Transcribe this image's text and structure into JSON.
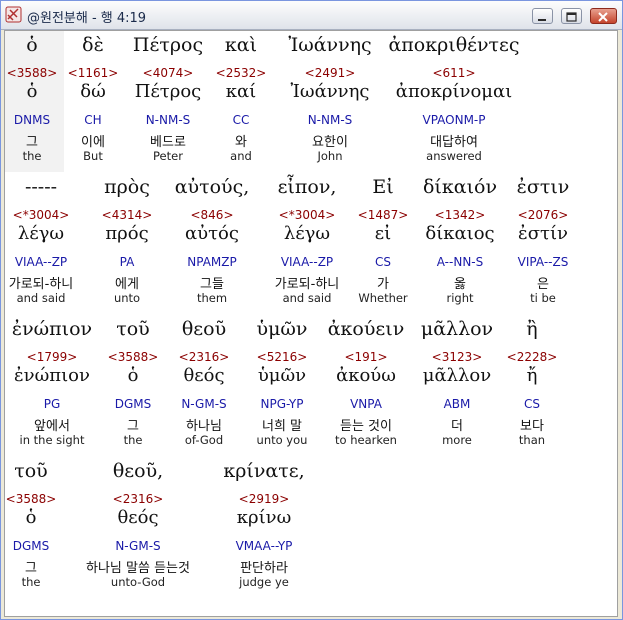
{
  "window": {
    "title": "@원전분해 - 행 4:19"
  },
  "rows": [
    [
      {
        "greek": "ὁ",
        "strong": "<3588>",
        "lemma": "ὁ",
        "parse": "DNMS",
        "korean": "그",
        "english": "the"
      },
      {
        "greek": "δὲ",
        "strong": "<1161>",
        "lemma": "δώ",
        "parse": "CH",
        "korean": "이에",
        "english": "But"
      },
      {
        "greek": "Πέτρος",
        "strong": "<4074>",
        "lemma": "Πέτρος",
        "parse": "N-NM-S",
        "korean": "베드로",
        "english": "Peter"
      },
      {
        "greek": "καὶ",
        "strong": "<2532>",
        "lemma": "καί",
        "parse": "CC",
        "korean": "와",
        "english": "and"
      },
      {
        "greek": "Ἰωάννης",
        "strong": "<2491>",
        "lemma": "Ἰωάννης",
        "parse": "N-NM-S",
        "korean": "요한이",
        "english": "John"
      },
      {
        "greek": "ἀποκριθέντες",
        "strong": "<611>",
        "lemma": "ἀποκρίνομαι",
        "parse": "VPAONM-P",
        "korean": "대답하여",
        "english": "answered"
      }
    ],
    [
      {
        "greek": "-----",
        "strong": "<*3004>",
        "lemma": "λέγω",
        "parse": "VIAA--ZP",
        "korean": "가로되-하니",
        "english": "and said"
      },
      {
        "greek": "πρὸς",
        "strong": "<4314>",
        "lemma": "πρός",
        "parse": "PA",
        "korean": "에게",
        "english": "unto"
      },
      {
        "greek": "αὐτούς,",
        "strong": "<846>",
        "lemma": "αὐτός",
        "parse": "NPAMZP",
        "korean": "그들",
        "english": "them"
      },
      {
        "greek": "εἶπον,",
        "strong": "<*3004>",
        "lemma": "λέγω",
        "parse": "VIAA--ZP",
        "korean": "가로되-하니",
        "english": "and said"
      },
      {
        "greek": "Εἰ",
        "strong": "<1487>",
        "lemma": "εἰ",
        "parse": "CS",
        "korean": "가",
        "english": "Whether"
      },
      {
        "greek": "δίκαιόν",
        "strong": "<1342>",
        "lemma": "δίκαιος",
        "parse": "A--NN-S",
        "korean": "옳",
        "english": "right"
      },
      {
        "greek": "ἐστιν",
        "strong": "<2076>",
        "lemma": "ἐστίν",
        "parse": "VIPA--ZS",
        "korean": "은",
        "english": "ti be"
      }
    ],
    [
      {
        "greek": "ἐνώπιον",
        "strong": "<1799>",
        "lemma": "ἐνώπιον",
        "parse": "PG",
        "korean": "앞에서",
        "english": "in the sight"
      },
      {
        "greek": "τοῦ",
        "strong": "<3588>",
        "lemma": "ὁ",
        "parse": "DGMS",
        "korean": "그",
        "english": "the"
      },
      {
        "greek": "θεοῦ",
        "strong": "<2316>",
        "lemma": "θεός",
        "parse": "N-GM-S",
        "korean": "하나님",
        "english": "of-God"
      },
      {
        "greek": "ὑμῶν",
        "strong": "<5216>",
        "lemma": "ὑμῶν",
        "parse": "NPG-YP",
        "korean": "너희 말",
        "english": "unto you"
      },
      {
        "greek": "ἀκούειν",
        "strong": "<191>",
        "lemma": "ἀκούω",
        "parse": "VNPA",
        "korean": "듣는 것이",
        "english": "to hearken"
      },
      {
        "greek": "μᾶλλον",
        "strong": "<3123>",
        "lemma": "μᾶλλον",
        "parse": "ABM",
        "korean": "더",
        "english": "more"
      },
      {
        "greek": "ἢ",
        "strong": "<2228>",
        "lemma": "ἤ",
        "parse": "CS",
        "korean": "보다",
        "english": "than"
      }
    ],
    [
      {
        "greek": "τοῦ",
        "strong": "<3588>",
        "lemma": "ὁ",
        "parse": "DGMS",
        "korean": "그",
        "english": "the"
      },
      {
        "greek": "θεοῦ,",
        "strong": "<2316>",
        "lemma": "θεός",
        "parse": "N-GM-S",
        "korean": "하나님 말씀 듣는것",
        "english": "unto-God"
      },
      {
        "greek": "κρίνατε,",
        "strong": "<2919>",
        "lemma": "κρίνω",
        "parse": "VMAA--YP",
        "korean": "판단하라",
        "english": "judge ye"
      }
    ]
  ]
}
